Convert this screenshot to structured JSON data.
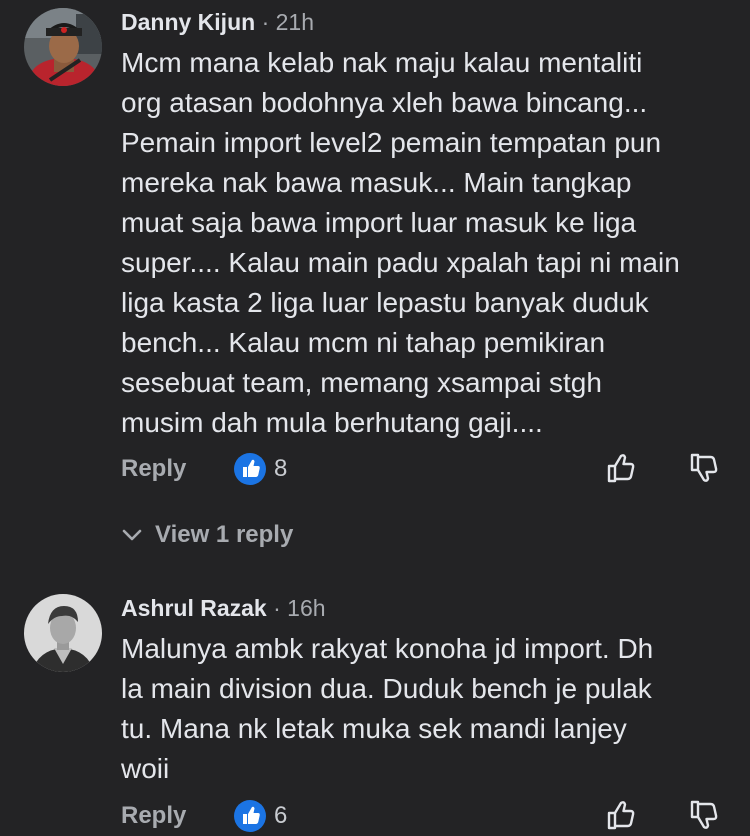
{
  "comments": [
    {
      "author": "Danny Kijun",
      "separator": "·",
      "time": "21h",
      "text": "Mcm mana kelab nak maju kalau mentaliti\norg atasan bodohnya xleh bawa bincang...\nPemain import level2 pemain tempatan pun\nmereka nak bawa masuk... Main tangkap\nmuat saja bawa import luar masuk ke liga\nsuper.... Kalau main padu xpalah tapi ni main\nliga kasta 2 liga luar lepastu banyak duduk\nbench... Kalau mcm ni tahap pemikiran\nsesebuat team, memang xsampai stgh\nmusim dah mula berhutang gaji....",
      "reply_label": "Reply",
      "like_count": "8",
      "view_replies_label": "View 1 reply"
    },
    {
      "author": "Ashrul Razak",
      "separator": "·",
      "time": "16h",
      "text": "Malunya ambk rakyat konoha jd import. Dh\nla main division dua. Duduk bench je pulak\ntu. Mana nk letak muka sek mandi lanjey\nwoii",
      "reply_label": "Reply",
      "like_count": "6"
    }
  ],
  "icons": {
    "like_badge": "thumbs-up-icon",
    "upvote": "thumbs-up-outline-icon",
    "downvote": "thumbs-down-outline-icon",
    "expand": "chevron-down-icon"
  },
  "colors": {
    "background": "#232325",
    "text_primary": "#e4e6eb",
    "text_secondary": "#a8abb0",
    "like_blue": "#1b74e4"
  }
}
